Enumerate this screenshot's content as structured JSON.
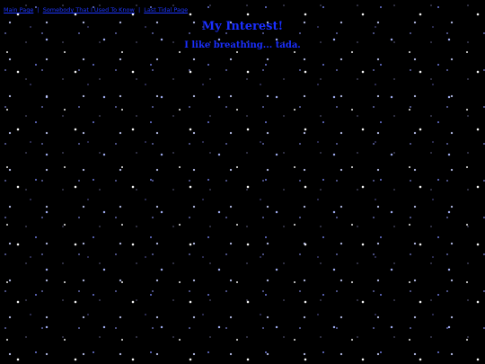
{
  "nav": {
    "links": [
      "Main Page",
      "Somebody That I Used To Know",
      "Last Tidal Page"
    ],
    "separator": "|"
  },
  "page": {
    "title": "My Interest!",
    "subtitle": "I like breathing... tada."
  },
  "colors": {
    "background": "#000000",
    "text": "#1a2fff",
    "link": "#1e37ff",
    "star": "#ffffff",
    "star_blue": "#a9b6ff"
  }
}
